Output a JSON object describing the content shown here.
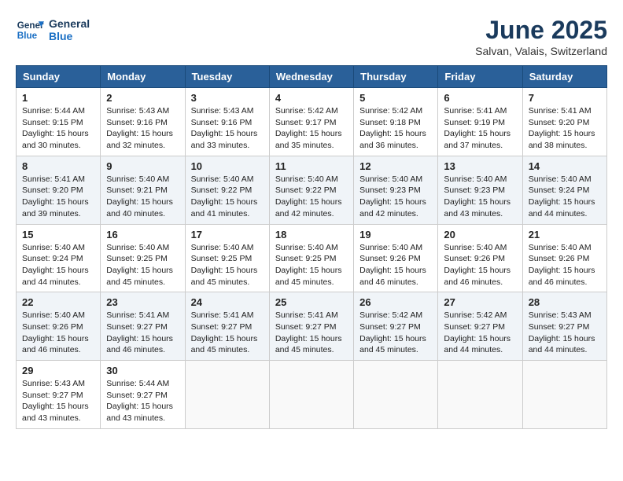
{
  "header": {
    "logo_line1": "General",
    "logo_line2": "Blue",
    "month": "June 2025",
    "location": "Salvan, Valais, Switzerland"
  },
  "columns": [
    "Sunday",
    "Monday",
    "Tuesday",
    "Wednesday",
    "Thursday",
    "Friday",
    "Saturday"
  ],
  "weeks": [
    [
      {
        "day": "1",
        "sunrise": "Sunrise: 5:44 AM",
        "sunset": "Sunset: 9:15 PM",
        "daylight": "Daylight: 15 hours and 30 minutes."
      },
      {
        "day": "2",
        "sunrise": "Sunrise: 5:43 AM",
        "sunset": "Sunset: 9:16 PM",
        "daylight": "Daylight: 15 hours and 32 minutes."
      },
      {
        "day": "3",
        "sunrise": "Sunrise: 5:43 AM",
        "sunset": "Sunset: 9:16 PM",
        "daylight": "Daylight: 15 hours and 33 minutes."
      },
      {
        "day": "4",
        "sunrise": "Sunrise: 5:42 AM",
        "sunset": "Sunset: 9:17 PM",
        "daylight": "Daylight: 15 hours and 35 minutes."
      },
      {
        "day": "5",
        "sunrise": "Sunrise: 5:42 AM",
        "sunset": "Sunset: 9:18 PM",
        "daylight": "Daylight: 15 hours and 36 minutes."
      },
      {
        "day": "6",
        "sunrise": "Sunrise: 5:41 AM",
        "sunset": "Sunset: 9:19 PM",
        "daylight": "Daylight: 15 hours and 37 minutes."
      },
      {
        "day": "7",
        "sunrise": "Sunrise: 5:41 AM",
        "sunset": "Sunset: 9:20 PM",
        "daylight": "Daylight: 15 hours and 38 minutes."
      }
    ],
    [
      {
        "day": "8",
        "sunrise": "Sunrise: 5:41 AM",
        "sunset": "Sunset: 9:20 PM",
        "daylight": "Daylight: 15 hours and 39 minutes."
      },
      {
        "day": "9",
        "sunrise": "Sunrise: 5:40 AM",
        "sunset": "Sunset: 9:21 PM",
        "daylight": "Daylight: 15 hours and 40 minutes."
      },
      {
        "day": "10",
        "sunrise": "Sunrise: 5:40 AM",
        "sunset": "Sunset: 9:22 PM",
        "daylight": "Daylight: 15 hours and 41 minutes."
      },
      {
        "day": "11",
        "sunrise": "Sunrise: 5:40 AM",
        "sunset": "Sunset: 9:22 PM",
        "daylight": "Daylight: 15 hours and 42 minutes."
      },
      {
        "day": "12",
        "sunrise": "Sunrise: 5:40 AM",
        "sunset": "Sunset: 9:23 PM",
        "daylight": "Daylight: 15 hours and 42 minutes."
      },
      {
        "day": "13",
        "sunrise": "Sunrise: 5:40 AM",
        "sunset": "Sunset: 9:23 PM",
        "daylight": "Daylight: 15 hours and 43 minutes."
      },
      {
        "day": "14",
        "sunrise": "Sunrise: 5:40 AM",
        "sunset": "Sunset: 9:24 PM",
        "daylight": "Daylight: 15 hours and 44 minutes."
      }
    ],
    [
      {
        "day": "15",
        "sunrise": "Sunrise: 5:40 AM",
        "sunset": "Sunset: 9:24 PM",
        "daylight": "Daylight: 15 hours and 44 minutes."
      },
      {
        "day": "16",
        "sunrise": "Sunrise: 5:40 AM",
        "sunset": "Sunset: 9:25 PM",
        "daylight": "Daylight: 15 hours and 45 minutes."
      },
      {
        "day": "17",
        "sunrise": "Sunrise: 5:40 AM",
        "sunset": "Sunset: 9:25 PM",
        "daylight": "Daylight: 15 hours and 45 minutes."
      },
      {
        "day": "18",
        "sunrise": "Sunrise: 5:40 AM",
        "sunset": "Sunset: 9:25 PM",
        "daylight": "Daylight: 15 hours and 45 minutes."
      },
      {
        "day": "19",
        "sunrise": "Sunrise: 5:40 AM",
        "sunset": "Sunset: 9:26 PM",
        "daylight": "Daylight: 15 hours and 46 minutes."
      },
      {
        "day": "20",
        "sunrise": "Sunrise: 5:40 AM",
        "sunset": "Sunset: 9:26 PM",
        "daylight": "Daylight: 15 hours and 46 minutes."
      },
      {
        "day": "21",
        "sunrise": "Sunrise: 5:40 AM",
        "sunset": "Sunset: 9:26 PM",
        "daylight": "Daylight: 15 hours and 46 minutes."
      }
    ],
    [
      {
        "day": "22",
        "sunrise": "Sunrise: 5:40 AM",
        "sunset": "Sunset: 9:26 PM",
        "daylight": "Daylight: 15 hours and 46 minutes."
      },
      {
        "day": "23",
        "sunrise": "Sunrise: 5:41 AM",
        "sunset": "Sunset: 9:27 PM",
        "daylight": "Daylight: 15 hours and 46 minutes."
      },
      {
        "day": "24",
        "sunrise": "Sunrise: 5:41 AM",
        "sunset": "Sunset: 9:27 PM",
        "daylight": "Daylight: 15 hours and 45 minutes."
      },
      {
        "day": "25",
        "sunrise": "Sunrise: 5:41 AM",
        "sunset": "Sunset: 9:27 PM",
        "daylight": "Daylight: 15 hours and 45 minutes."
      },
      {
        "day": "26",
        "sunrise": "Sunrise: 5:42 AM",
        "sunset": "Sunset: 9:27 PM",
        "daylight": "Daylight: 15 hours and 45 minutes."
      },
      {
        "day": "27",
        "sunrise": "Sunrise: 5:42 AM",
        "sunset": "Sunset: 9:27 PM",
        "daylight": "Daylight: 15 hours and 44 minutes."
      },
      {
        "day": "28",
        "sunrise": "Sunrise: 5:43 AM",
        "sunset": "Sunset: 9:27 PM",
        "daylight": "Daylight: 15 hours and 44 minutes."
      }
    ],
    [
      {
        "day": "29",
        "sunrise": "Sunrise: 5:43 AM",
        "sunset": "Sunset: 9:27 PM",
        "daylight": "Daylight: 15 hours and 43 minutes."
      },
      {
        "day": "30",
        "sunrise": "Sunrise: 5:44 AM",
        "sunset": "Sunset: 9:27 PM",
        "daylight": "Daylight: 15 hours and 43 minutes."
      },
      null,
      null,
      null,
      null,
      null
    ]
  ]
}
